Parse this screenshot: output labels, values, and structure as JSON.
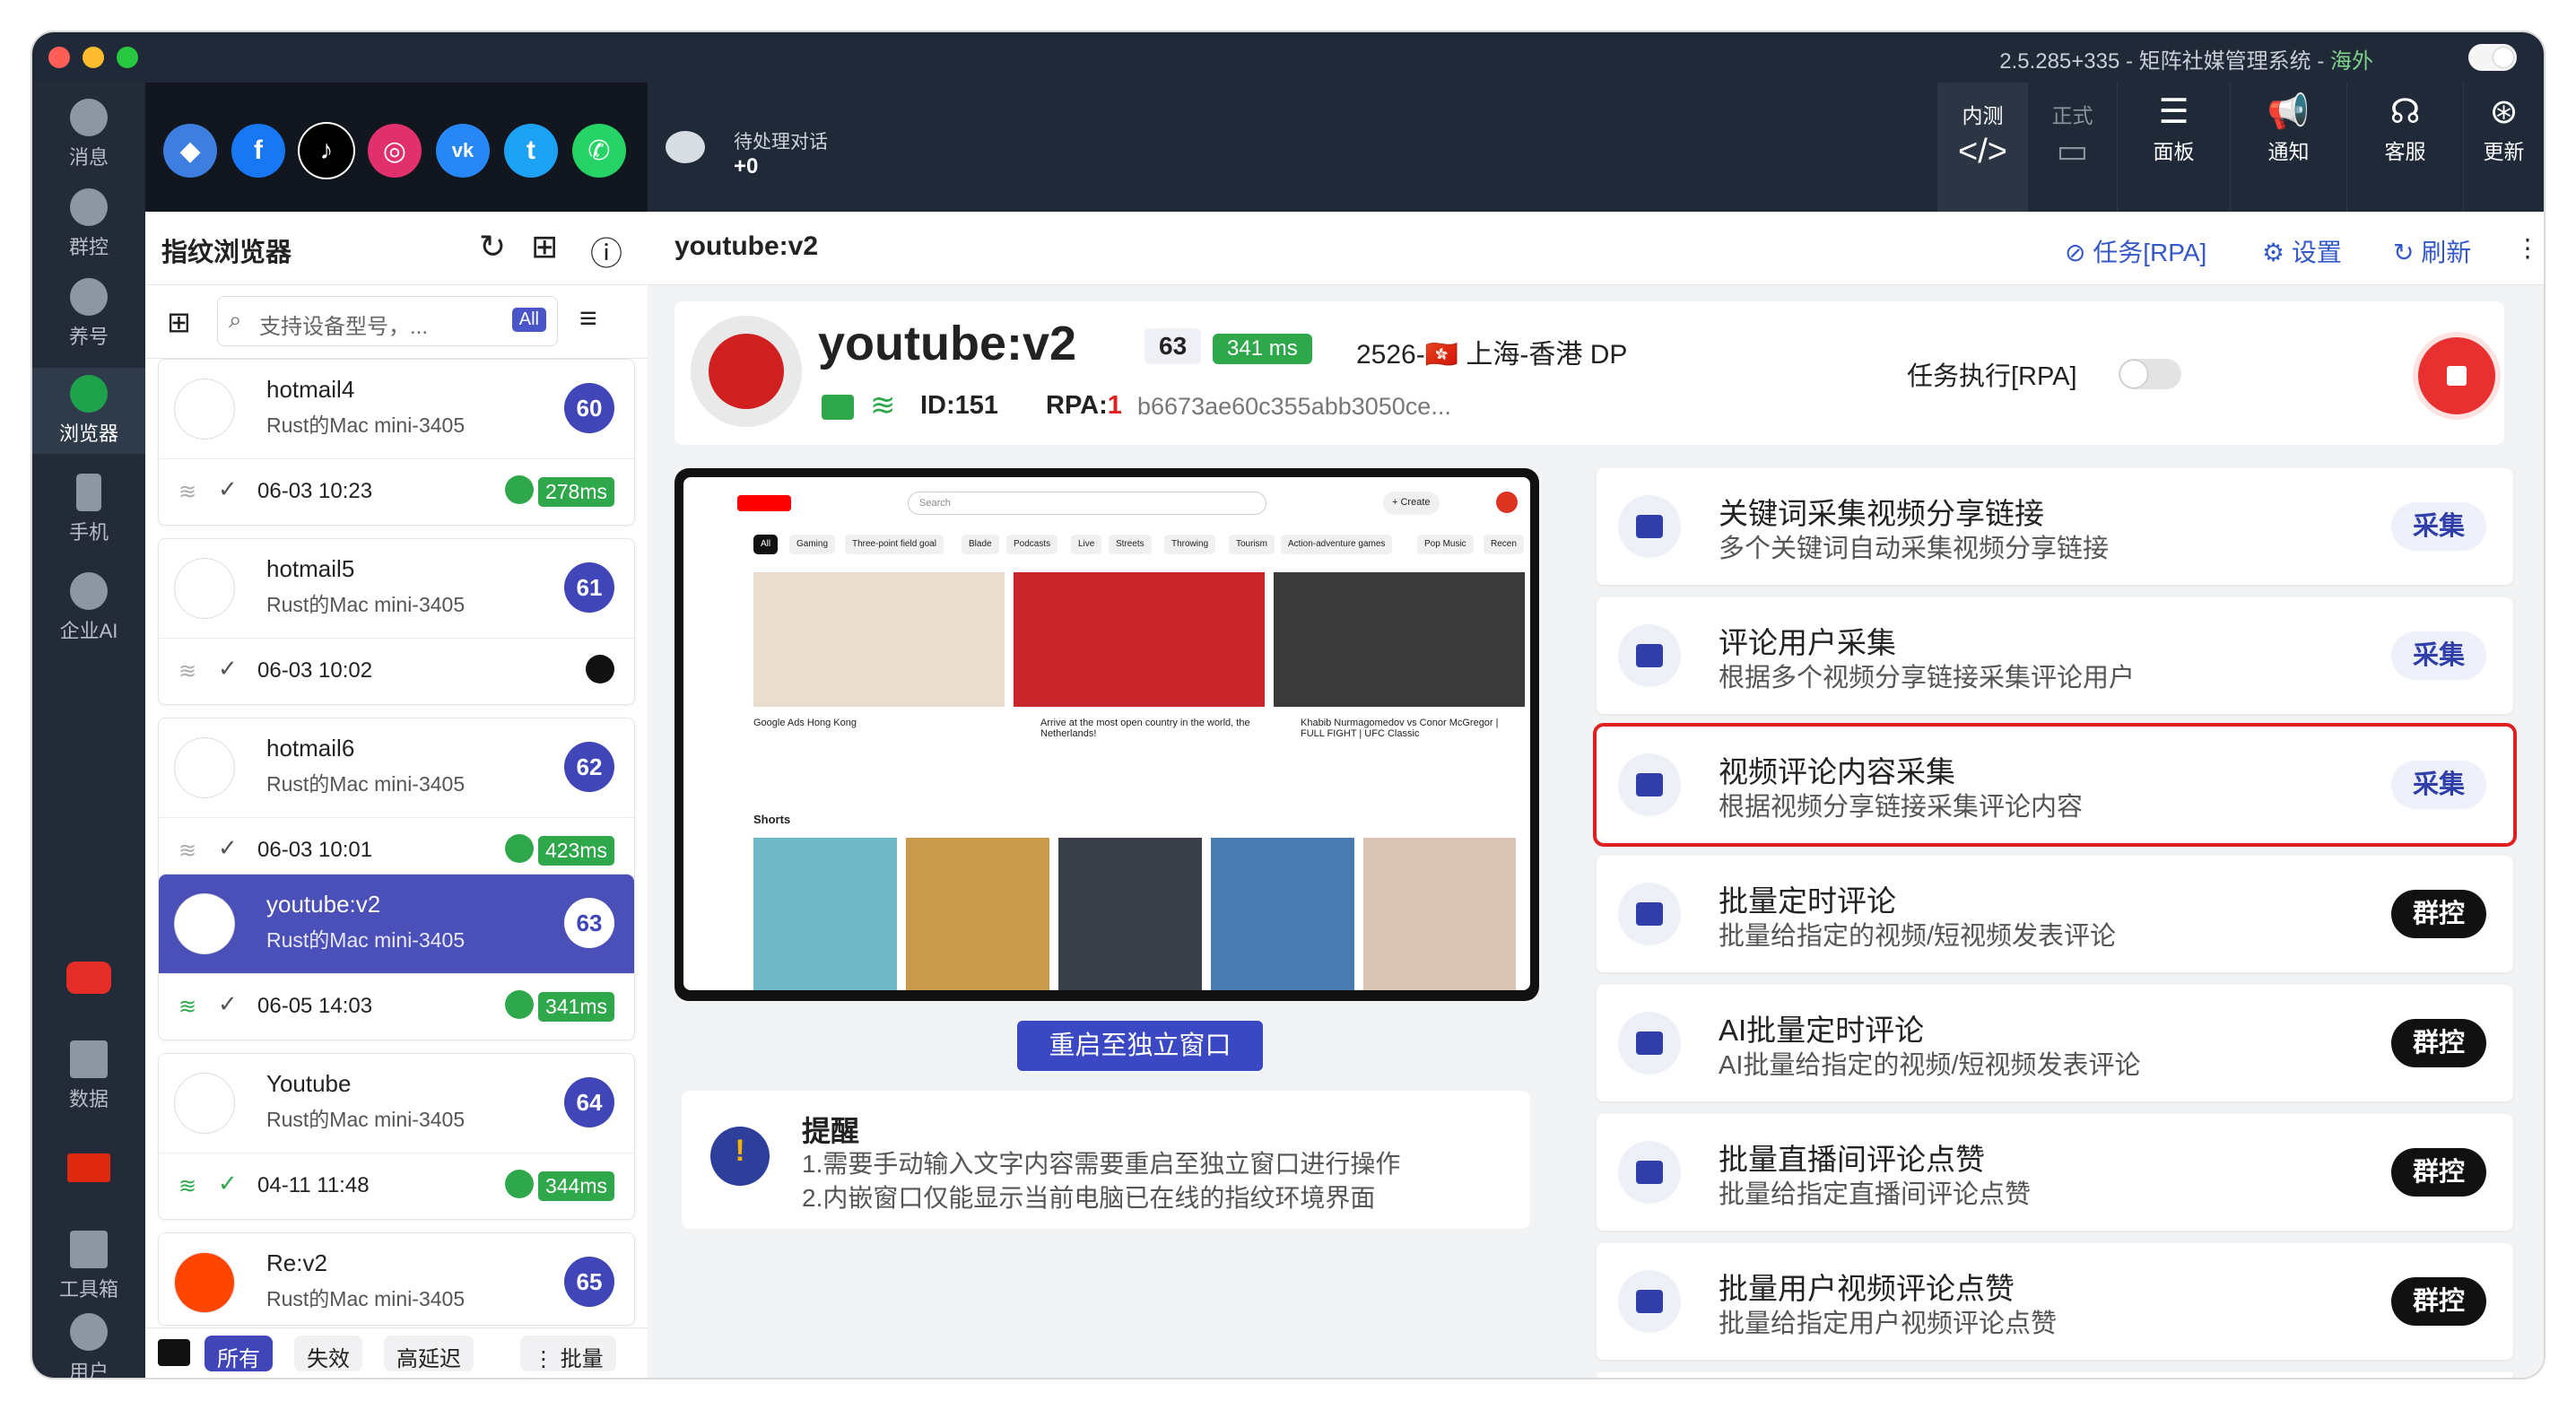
{
  "window": {
    "title": "2.5.285+335 - 矩阵社媒管理系统 - ",
    "region": "海外"
  },
  "rail": [
    {
      "label": "消息",
      "icon": "message-icon"
    },
    {
      "label": "群控",
      "icon": "group-control-icon"
    },
    {
      "label": "养号",
      "icon": "nurture-icon"
    },
    {
      "label": "浏览器",
      "icon": "browser-icon"
    },
    {
      "label": "手机",
      "icon": "phone-icon"
    },
    {
      "label": "企业AI",
      "icon": "ai-icon"
    },
    {
      "label": "",
      "icon": "youtube-icon"
    },
    {
      "label": "数据",
      "icon": "chart-icon"
    },
    {
      "label": "",
      "icon": "china-flag-icon"
    },
    {
      "label": "工具箱",
      "icon": "toolbox-icon"
    },
    {
      "label": "用户",
      "icon": "user-icon"
    }
  ],
  "socials": [
    "browser",
    "facebook",
    "tiktok",
    "instagram",
    "vk",
    "twitter",
    "whatsapp"
  ],
  "pending": {
    "label": "待处理对话",
    "value": "+0"
  },
  "toolbar": {
    "beta": "内测",
    "release": "正式",
    "panel": "面板",
    "notify": "通知",
    "service": "客服",
    "update": "更新"
  },
  "sidepanel": {
    "title": "指纹浏览器",
    "search_placeholder": "支持设备型号，...",
    "search_filter": "All",
    "profiles": [
      {
        "name": "hotmail4",
        "device": "Rust的Mac mini-3405",
        "num": "60",
        "time": "06-03 10:23",
        "ms": "278ms"
      },
      {
        "name": "hotmail5",
        "device": "Rust的Mac mini-3405",
        "num": "61",
        "time": "06-03 10:02",
        "ms": ""
      },
      {
        "name": "hotmail6",
        "device": "Rust的Mac mini-3405",
        "num": "62",
        "time": "06-03 10:01",
        "ms": "423ms"
      },
      {
        "name": "youtube:v2",
        "device": "Rust的Mac mini-3405",
        "num": "63",
        "time": "06-05 14:03",
        "ms": "341ms"
      },
      {
        "name": "Youtube",
        "device": "Rust的Mac mini-3405",
        "num": "64",
        "time": "04-11 11:48",
        "ms": "344ms"
      },
      {
        "name": "Re:v2",
        "device": "Rust的Mac mini-3405",
        "num": "65",
        "time": "",
        "ms": ""
      }
    ],
    "filters": {
      "all": "所有",
      "invalid": "失效",
      "high_latency": "高延迟",
      "batch": "批量"
    }
  },
  "main": {
    "title": "youtube:v2",
    "links": {
      "task": "任务[RPA]",
      "settings": "设置",
      "refresh": "刷新"
    },
    "info": {
      "name": "youtube:v2",
      "num": "63",
      "ms": "341 ms",
      "location": "2526-🇭🇰 上海-香港 DP",
      "id": "ID:151",
      "rpa_label": "RPA:",
      "rpa_value": "1",
      "hash": "b6673ae60c355abb3050ce...",
      "task_label": "任务执行[RPA]"
    },
    "preview": {
      "search": "Search",
      "create": "+ Create",
      "chips": [
        "All",
        "Gaming",
        "Three-point field goal",
        "Blade",
        "Podcasts",
        "Live",
        "Streets",
        "Throwing",
        "Tourism",
        "Action-adventure games",
        "Pop Music",
        "Recen"
      ],
      "shorts": "Shorts",
      "videos": [
        "Google Ads Hong Kong",
        "Arrive at the most open country in the world, the Netherlands!",
        "Khabib Nurmagomedov vs Conor McGregor | FULL FIGHT | UFC Classic"
      ]
    },
    "restart": "重启至独立窗口",
    "tips": {
      "title": "提醒",
      "line1": "1.需要手动输入文字内容需要重启至独立窗口进行操作",
      "line2": "2.内嵌窗口仅能显示当前电脑已在线的指纹环境界面"
    },
    "features": [
      {
        "title": "关键词采集视频分享链接",
        "desc": "多个关键词自动采集视频分享链接",
        "btn": "采集"
      },
      {
        "title": "评论用户采集",
        "desc": "根据多个视频分享链接采集评论用户",
        "btn": "采集"
      },
      {
        "title": "视频评论内容采集",
        "desc": "根据视频分享链接采集评论内容",
        "btn": "采集"
      },
      {
        "title": "批量定时评论",
        "desc": "批量给指定的视频/短视频发表评论",
        "btn": "群控"
      },
      {
        "title": "AI批量定时评论",
        "desc": "AI批量给指定的视频/短视频发表评论",
        "btn": "群控"
      },
      {
        "title": "批量直播间评论点赞",
        "desc": "批量给指定直播间评论点赞",
        "btn": "群控"
      },
      {
        "title": "批量用户视频评论点赞",
        "desc": "批量给指定用户视频评论点赞",
        "btn": "群控"
      }
    ]
  }
}
